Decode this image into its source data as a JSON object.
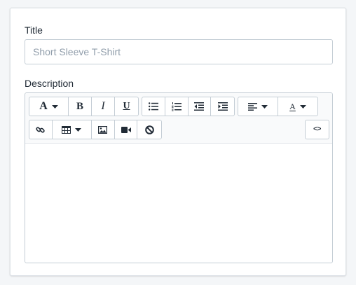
{
  "form": {
    "title_label": "Title",
    "title_placeholder": "Short Sleeve T-Shirt",
    "title_value": "",
    "description_label": "Description"
  },
  "toolbar": {
    "font_glyph": "A",
    "bold_glyph": "B",
    "italic_glyph": "I",
    "underline_glyph": "U",
    "font_color_glyph": "A",
    "code_glyph": "<>",
    "icons": [
      "font-icon",
      "bold-icon",
      "italic-icon",
      "underline-icon",
      "bullet-list-icon",
      "numbered-list-icon",
      "outdent-icon",
      "indent-icon",
      "align-left-icon",
      "font-color-icon",
      "link-icon",
      "table-icon",
      "image-icon",
      "video-icon",
      "clear-format-icon",
      "html-code-icon"
    ]
  },
  "editor": {
    "content": ""
  }
}
